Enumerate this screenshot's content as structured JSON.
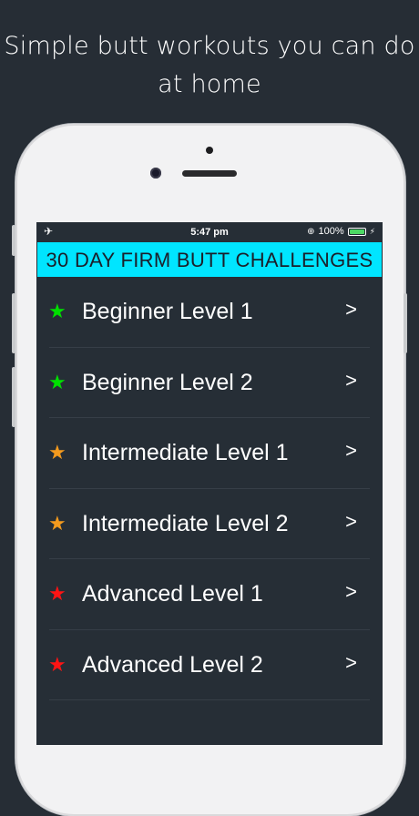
{
  "headline": "Simple butt workouts you can do at home",
  "status_bar": {
    "airplane_icon": "airplane-icon",
    "time": "5:47 pm",
    "battery_percent": "100%"
  },
  "header_title": "30 DAY FIRM BUTT CHALLENGES",
  "levels": [
    {
      "label": "Beginner Level 1",
      "star_color": "#00e000"
    },
    {
      "label": "Beginner Level 2",
      "star_color": "#00e000"
    },
    {
      "label": "Intermediate Level 1",
      "star_color": "#f39a1e"
    },
    {
      "label": "Intermediate Level 2",
      "star_color": "#f39a1e"
    },
    {
      "label": "Advanced Level 1",
      "star_color": "#ff1414"
    },
    {
      "label": "Advanced Level 2",
      "star_color": "#ff1414"
    }
  ],
  "colors": {
    "background": "#262d35",
    "header_bar": "#00e5ff",
    "battery": "#4cd964"
  }
}
